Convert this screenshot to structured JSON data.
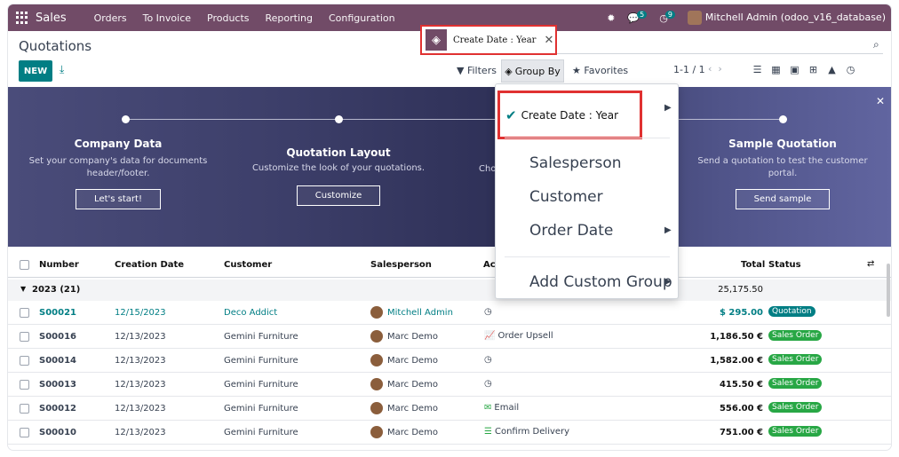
{
  "nav": {
    "brand": "Sales",
    "menu": [
      "Orders",
      "To Invoice",
      "Products",
      "Reporting",
      "Configuration"
    ],
    "messages_count": "5",
    "activities_count": "9",
    "user": "Mitchell Admin (odoo_v16_database)"
  },
  "control": {
    "title": "Quotations",
    "new_label": "NEW",
    "facet_label": "Create Date : Year",
    "filters_label": "Filters",
    "groupby_label": "Group By",
    "favorites_label": "Favorites",
    "pager": "1-1 / 1"
  },
  "banner": {
    "steps": [
      {
        "title": "Company Data",
        "desc": "Set your company's data for documents header/footer.",
        "button": "Let's start!"
      },
      {
        "title": "Quotation Layout",
        "desc": "Customize the look of your quotations.",
        "button": "Customize"
      },
      {
        "title": "Sample Quotation",
        "desc": "Send a quotation to test the customer portal.",
        "button": "Send sample"
      }
    ],
    "partial_text": "Cho"
  },
  "table": {
    "headers": {
      "number": "Number",
      "creation_date": "Creation Date",
      "customer": "Customer",
      "salesperson": "Salesperson",
      "activities": "Act",
      "total": "Total",
      "status": "Status"
    },
    "group": {
      "label": "2023 (21)",
      "total": "25,175.50"
    },
    "rows": [
      {
        "number": "S00021",
        "date": "12/15/2023",
        "customer": "Deco Addict",
        "salesperson": "Mitchell Admin",
        "activity": "",
        "activity_icon": "clock-icon",
        "total": "$ 295.00",
        "status": "Quotation",
        "highlight": true
      },
      {
        "number": "S00016",
        "date": "12/13/2023",
        "customer": "Gemini Furniture",
        "salesperson": "Marc Demo",
        "activity": "Order Upsell",
        "activity_icon": "chart-icon",
        "total": "1,186.50 €",
        "status": "Sales Order",
        "highlight": false
      },
      {
        "number": "S00014",
        "date": "12/13/2023",
        "customer": "Gemini Furniture",
        "salesperson": "Marc Demo",
        "activity": "",
        "activity_icon": "clock-icon",
        "total": "1,582.00 €",
        "status": "Sales Order",
        "highlight": false
      },
      {
        "number": "S00013",
        "date": "12/13/2023",
        "customer": "Gemini Furniture",
        "salesperson": "Marc Demo",
        "activity": "",
        "activity_icon": "clock-icon",
        "total": "415.50 €",
        "status": "Sales Order",
        "highlight": false
      },
      {
        "number": "S00012",
        "date": "12/13/2023",
        "customer": "Gemini Furniture",
        "salesperson": "Marc Demo",
        "activity": "Email",
        "activity_icon": "email-icon",
        "total": "556.00 €",
        "status": "Sales Order",
        "highlight": false
      },
      {
        "number": "S00010",
        "date": "12/13/2023",
        "customer": "Gemini Furniture",
        "salesperson": "Marc Demo",
        "activity": "Confirm Delivery",
        "activity_icon": "delivery-icon",
        "total": "751.00 €",
        "status": "Sales Order",
        "highlight": false
      }
    ]
  },
  "groupby_menu": {
    "items": [
      {
        "label": "Create Date : Year",
        "checked": true,
        "submenu": true
      },
      {
        "label": "Salesperson",
        "checked": false,
        "submenu": false
      },
      {
        "label": "Customer",
        "checked": false,
        "submenu": false
      },
      {
        "label": "Order Date",
        "checked": false,
        "submenu": true
      }
    ],
    "custom_label": "Add Custom Group"
  },
  "colors": {
    "brand": "#714B67",
    "accent": "#017e84",
    "success": "#28a745",
    "highlight_border": "#e03131"
  }
}
